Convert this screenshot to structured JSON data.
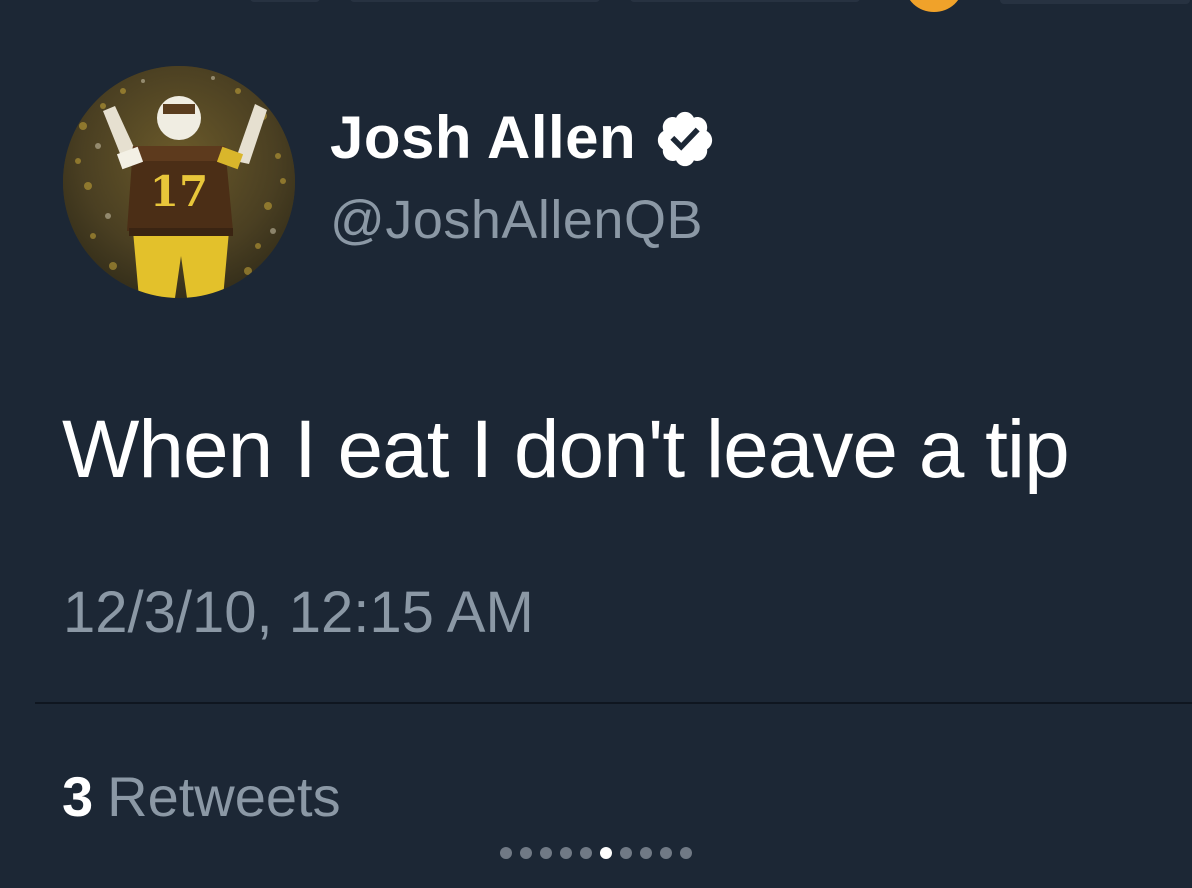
{
  "tweet": {
    "display_name": "Josh Allen",
    "handle": "@JoshAllenQB",
    "verified": true,
    "text": "When I eat I don't leave a tip",
    "timestamp": "12/3/10, 12:15 AM",
    "retweets_count": "3",
    "retweets_label": "Retweets",
    "avatar_jersey_number": "17"
  },
  "icons": {
    "verified": "verified-badge-icon"
  },
  "pager": {
    "total": 10,
    "active_index": 5
  },
  "colors": {
    "background": "#1c2735",
    "primary_text": "#ffffff",
    "secondary_text": "#8b98a5",
    "divider": "#0f1620"
  }
}
